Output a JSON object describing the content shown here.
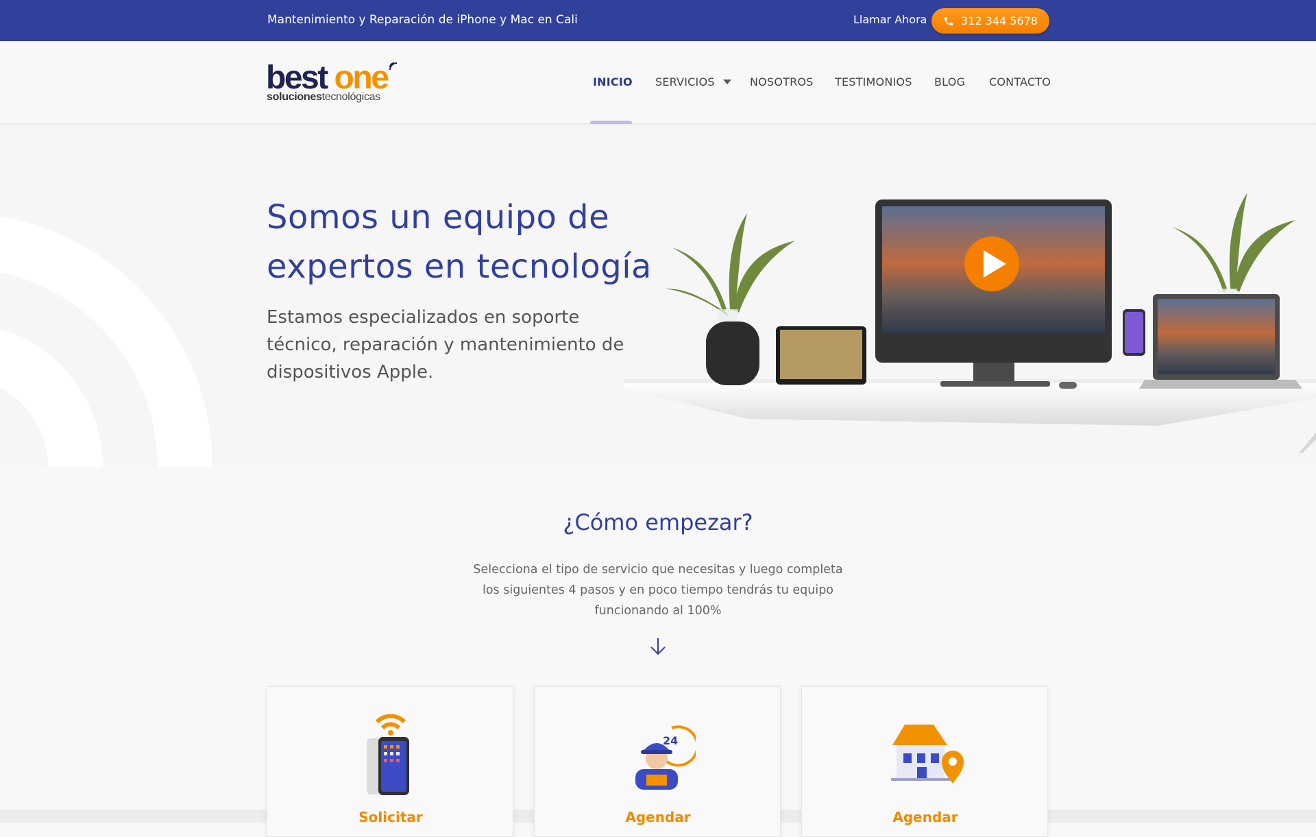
{
  "topbar": {
    "tagline": "Mantenimiento y Reparación de iPhone y Mac en Cali",
    "call_label": "Llamar Ahora",
    "phone": "312 344 5678"
  },
  "logo": {
    "brand_part1": "best",
    "brand_part2": "one",
    "sub_bold": "soluciones",
    "sub_regular": "tecnológicas"
  },
  "nav": {
    "items": [
      {
        "label": "INICIO",
        "active": true
      },
      {
        "label": "SERVICIOS",
        "dropdown": true
      },
      {
        "label": "NOSOTROS"
      },
      {
        "label": "TESTIMONIOS"
      },
      {
        "label": "BLOG"
      },
      {
        "label": "CONTACTO"
      }
    ]
  },
  "hero": {
    "title": "Somos un equipo de expertos en tecnología",
    "subtitle": "Estamos especializados en soporte técnico, reparación y mantenimiento de dispositivos Apple."
  },
  "start": {
    "title": "¿Cómo empezar?",
    "intro": "Selecciona el tipo de servicio que necesitas y luego completa los siguientes 4 pasos y en poco tiempo tendrás tu equipo funcionando al 100%"
  },
  "cards": [
    {
      "title": "Solicitar",
      "icon": "phone-wifi-icon"
    },
    {
      "title": "Agendar",
      "icon": "technician-24h-icon"
    },
    {
      "title": "Agendar",
      "icon": "house-location-icon"
    }
  ],
  "colors": {
    "primary": "#31409a",
    "accent": "#f39200"
  }
}
